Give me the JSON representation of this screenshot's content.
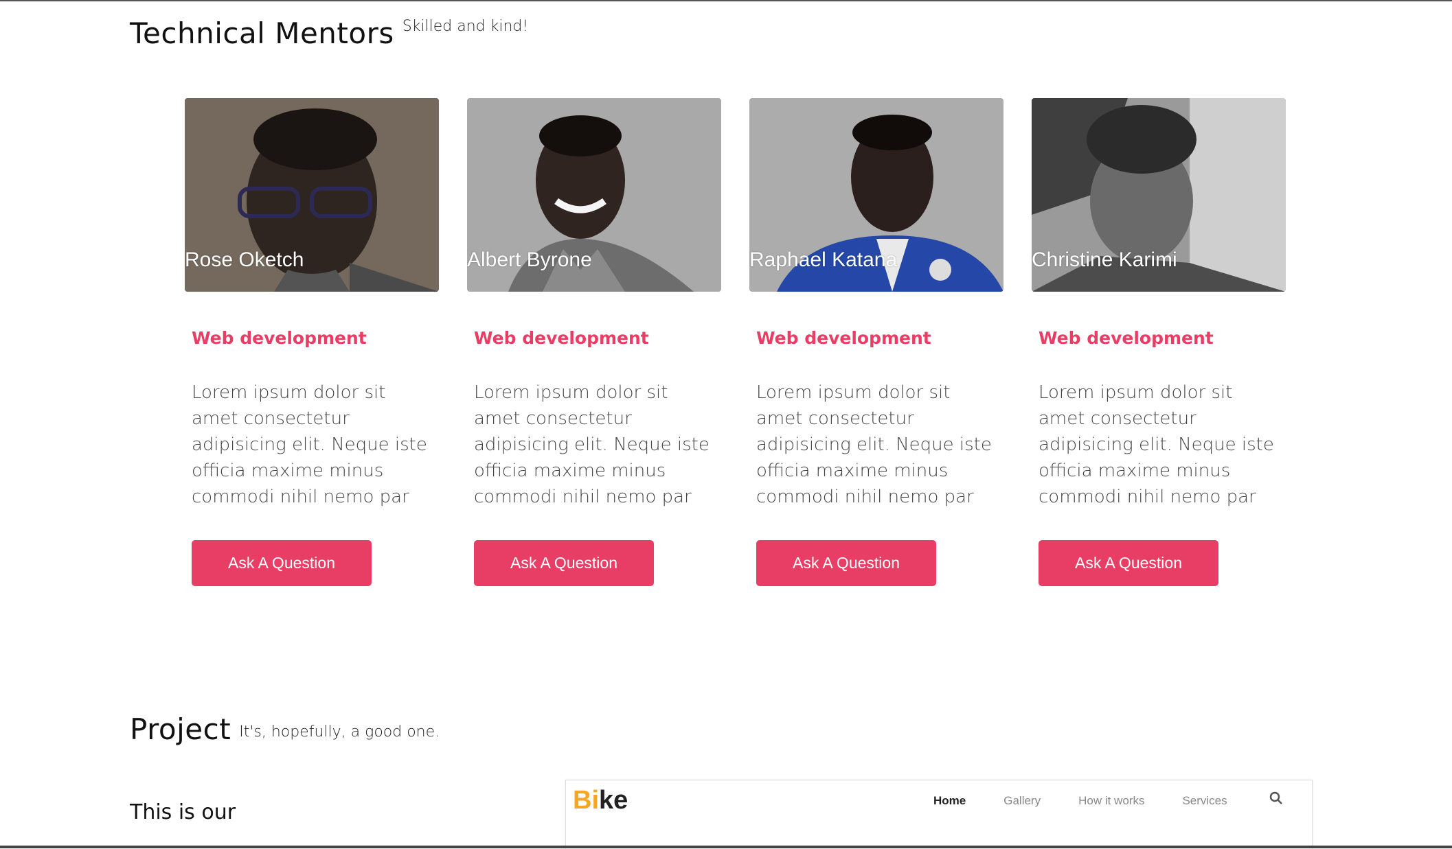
{
  "mentors_section": {
    "title": "Technical Mentors",
    "subtitle": "Skilled and kind!"
  },
  "mentors": [
    {
      "name": "Rose Oketch",
      "role": "Web development",
      "description": "Lorem ipsum dolor sit amet consectetur adipisicing elit. Neque iste officia maxime minus commodi nihil nemo par",
      "button_label": "Ask A Question"
    },
    {
      "name": "Albert Byrone",
      "role": "Web development",
      "description": "Lorem ipsum dolor sit amet consectetur adipisicing elit. Neque iste officia maxime minus commodi nihil nemo par",
      "button_label": "Ask A Question"
    },
    {
      "name": "Raphael Katana",
      "role": "Web development",
      "description": "Lorem ipsum dolor sit amet consectetur adipisicing elit. Neque iste officia maxime minus commodi nihil nemo par",
      "button_label": "Ask A Question"
    },
    {
      "name": "Christine Karimi",
      "role": "Web development",
      "description": "Lorem ipsum dolor sit amet consectetur adipisicing elit. Neque iste officia maxime minus commodi nihil nemo par",
      "button_label": "Ask A Question"
    }
  ],
  "project_section": {
    "title": "Project",
    "subtitle": "It's, hopefully, a good one.",
    "intro": "This is our"
  },
  "project_preview": {
    "logo_accent": "Bi",
    "logo_rest": "ke",
    "nav": [
      "Home",
      "Gallery",
      "How it works",
      "Services"
    ],
    "search_icon": "search-icon"
  },
  "colors": {
    "accent": "#e83e65",
    "logo_accent": "#f5a623"
  }
}
